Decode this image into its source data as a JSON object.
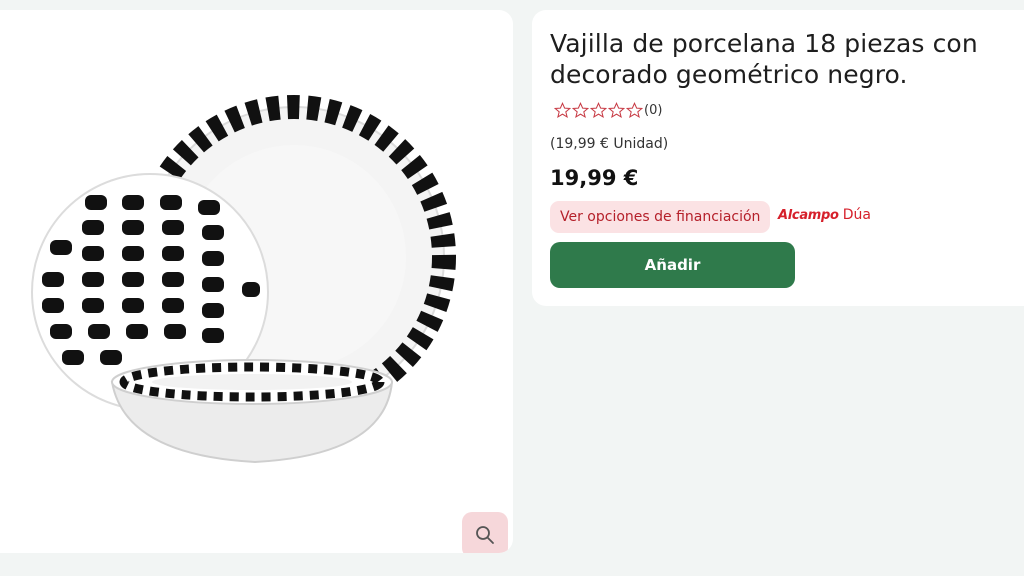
{
  "product": {
    "title": "Vajilla de porcelana 18 piezas con decorado geométrico negro.",
    "rating_count": "(0)",
    "unit_price": "(19,99 € Unidad)",
    "price": "19,99 €",
    "rating": 0,
    "rating_max": 5
  },
  "actions": {
    "financing_label": "Ver opciones de financiación",
    "add_label": "Añadir"
  },
  "brand": {
    "name": "Alcampo",
    "sub": "Dúa"
  },
  "colors": {
    "accent_green": "#2f7a4b",
    "accent_red": "#d6202b",
    "pink_bg": "#fbe2e4"
  },
  "icons": {
    "zoom": "magnifier-icon",
    "star": "star-outline-icon"
  }
}
